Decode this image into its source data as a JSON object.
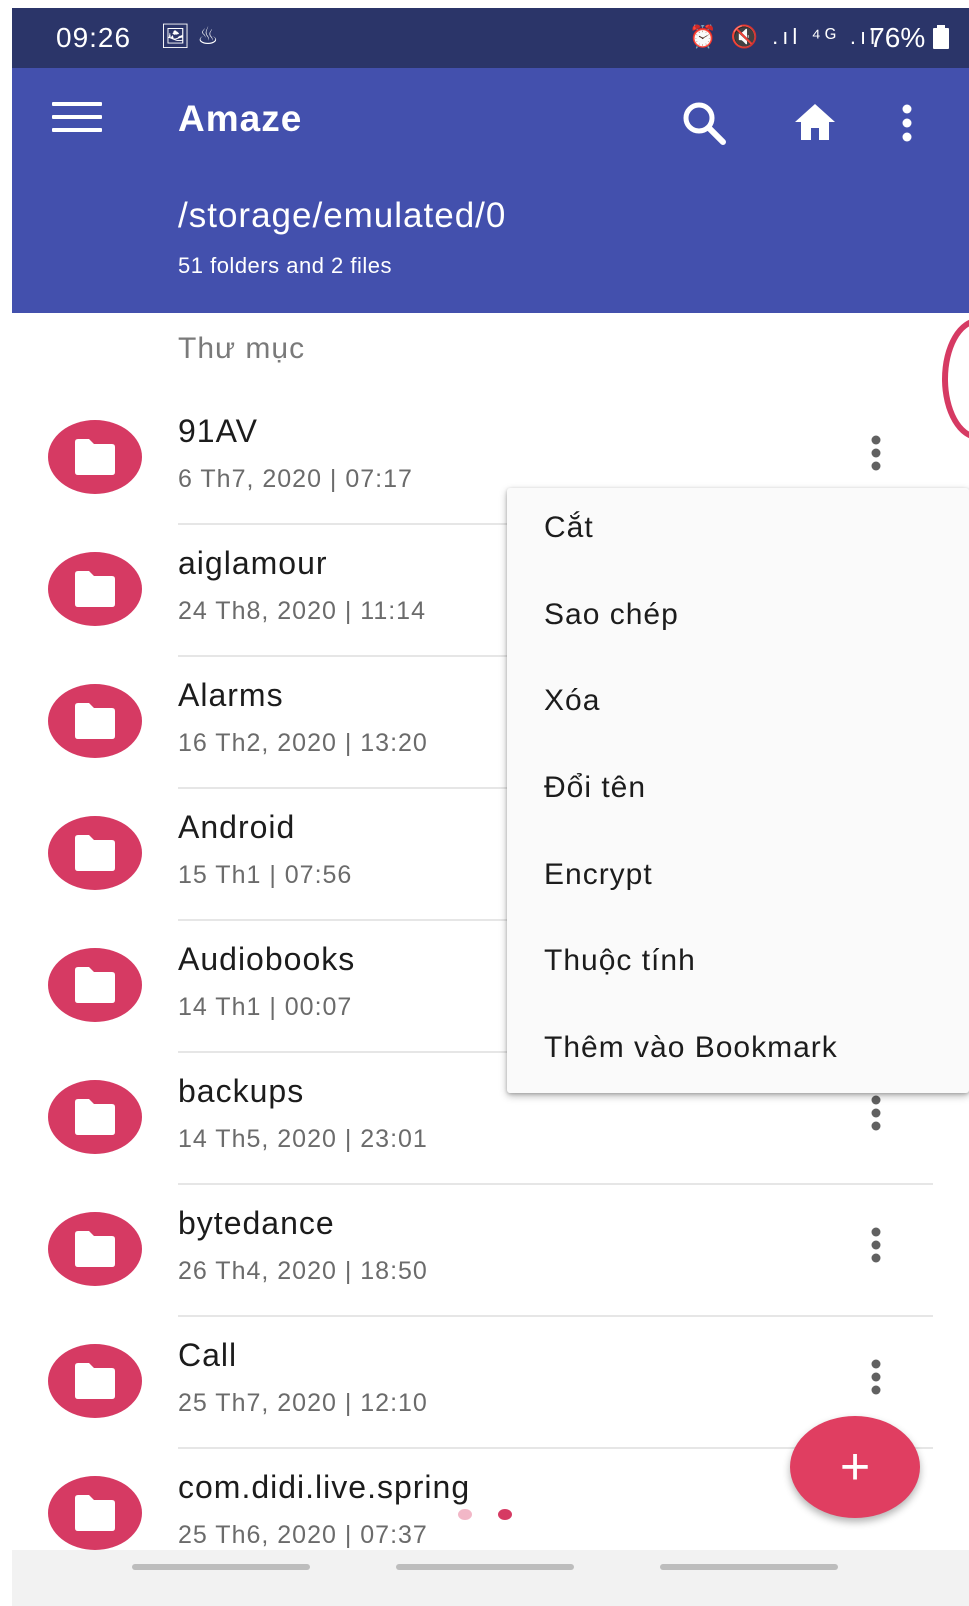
{
  "status_bar": {
    "time": "09:26",
    "left_icons": "🖼 ♨",
    "right_icons": "⏰ 🔇 .ıl ⁴ᴳ .ıl",
    "battery": "76%"
  },
  "app_bar": {
    "title": "Amaze",
    "path": "/storage/emulated/0",
    "subtitle": "51 folders and 2 files",
    "color": "#4350ad"
  },
  "list": {
    "section_header": "Thư mục",
    "items": [
      {
        "name": "91AV",
        "date": "6 Th7, 2020 | 07:17"
      },
      {
        "name": "aiglamour",
        "date": "24 Th8, 2020 | 11:14"
      },
      {
        "name": "Alarms",
        "date": "16 Th2, 2020 | 13:20"
      },
      {
        "name": "Android",
        "date": "15 Th1 | 07:56"
      },
      {
        "name": "Audiobooks",
        "date": "14 Th1 | 00:07"
      },
      {
        "name": "backups",
        "date": "14 Th5, 2020 | 23:01"
      },
      {
        "name": "bytedance",
        "date": "26 Th4, 2020 | 18:50"
      },
      {
        "name": "Call",
        "date": "25 Th7, 2020 | 12:10"
      },
      {
        "name": "com.didi.live.spring",
        "date": "25 Th6, 2020 | 07:37"
      }
    ]
  },
  "context_menu": {
    "items": [
      "Cắt",
      "Sao chép",
      "Xóa",
      "Đổi tên",
      "Encrypt",
      "Thuộc tính",
      "Thêm vào Bookmark"
    ]
  },
  "fab": {
    "label": "+",
    "color": "#e03e61"
  },
  "accent_color": "#d63a63"
}
